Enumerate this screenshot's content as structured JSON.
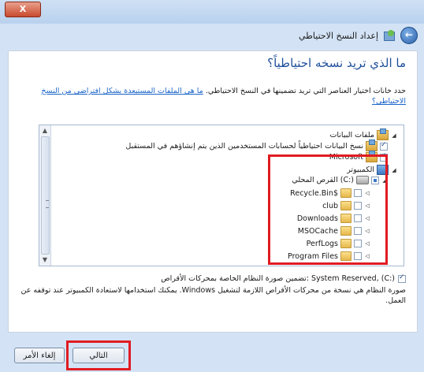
{
  "window": {
    "close_label": "X",
    "title": "إعداد النسخ الاحتياطي"
  },
  "page": {
    "heading": "ما الذي تريد نسخه احتياطياً؟",
    "intro_text": "حدد خانات اختيار العناصر التي تريد تضمينها في النسخ الاحتياطي.",
    "intro_link": "ما هي الملفات المستبعدة بشكل افتراضي من النسخ الاحتياطي؟"
  },
  "tree": {
    "libraries_label": "ملفات البيانات",
    "user_libraries_label": "نسخ البيانات احتياطياً لحسابات المستخدمين الذين يتم إنشاؤهم في المستقبل",
    "partial_label": "Microsoft",
    "computer_label": "الكمبيوتر",
    "drive_label": "القرص المحلي (C:)",
    "folders": [
      "Recycle.Bin$",
      "club",
      "Downloads",
      "MSOCache",
      "PerfLogs",
      "Program Files"
    ]
  },
  "include": {
    "label": "تضمين صورة النظام الخاصة بمحركات الأقراص: System Reserved, (C:)",
    "description": "صورة النظام هي نسخة من محركات الأقراص اللازمة لتشغيل Windows. يمكنك استخدامها لاستعادة الكمبيوتر عند توقفه عن العمل."
  },
  "buttons": {
    "next": "التالي",
    "cancel": "إلغاء الأمر"
  },
  "colors": {
    "highlight": "#e11b22",
    "heading": "#1e4f9a",
    "link": "#1a64c8"
  }
}
